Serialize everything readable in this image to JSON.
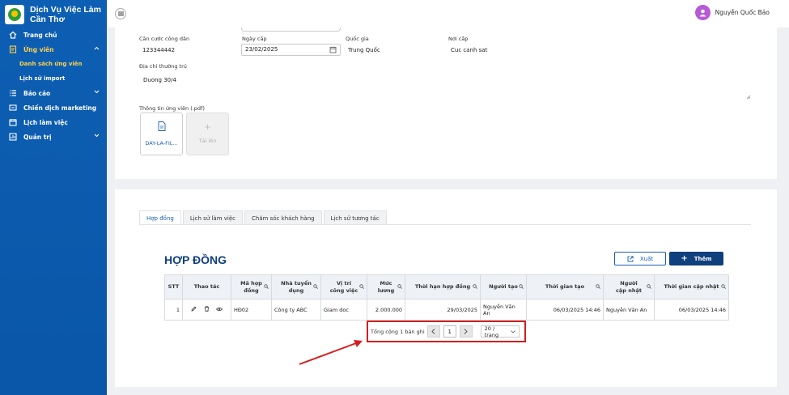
{
  "app": {
    "brand_line1": "Dịch Vụ Việc Làm",
    "brand_line2": "Cần Thơ"
  },
  "sidebar": {
    "items": [
      {
        "label": "Trang chủ",
        "icon": "home-icon"
      },
      {
        "label": "Ứng viên",
        "icon": "candidate-icon",
        "active": true
      },
      {
        "label": "Báo cáo",
        "icon": "list-icon"
      },
      {
        "label": "Chiến dịch marketing",
        "icon": "campaign-icon"
      },
      {
        "label": "Lịch làm việc",
        "icon": "calendar-icon"
      },
      {
        "label": "Quản trị",
        "icon": "admin-icon"
      }
    ],
    "subitems": [
      {
        "label": "Danh sách ứng viên",
        "active": true
      },
      {
        "label": "Lịch sử import"
      }
    ]
  },
  "topbar": {
    "user_name": "Nguyễn Quốc Bảo"
  },
  "form": {
    "cccd_label": "Căn cước công dân",
    "cccd_value": "123344442",
    "issue_date_label": "Ngày cấp",
    "issue_date_value": "23/02/2025",
    "country_label": "Quốc gia",
    "country_value": "Trung Quốc",
    "place_label": "Nơi cấp",
    "place_value": "Cuc canh sat",
    "address_label": "Địa chỉ thường trú",
    "address_value": "Duong 30/4",
    "files_label": "Thông tin ứng viên (.pdf)",
    "file_name": "DAY-LA-FIL...",
    "upload_label": "Tải lên"
  },
  "tabs": [
    "Hợp đồng",
    "Lịch sử làm việc",
    "Chăm sóc khách hàng",
    "Lịch sử tương tác"
  ],
  "section": {
    "title": "HỢP ĐỒNG",
    "export_label": "Xuất",
    "add_label": "Thêm"
  },
  "table": {
    "headers": [
      "STT",
      "Thao tác",
      "Mã hợp đồng",
      "Nhà tuyển dụng",
      "Vị trí công việc",
      "Mức lương",
      "Thời hạn hợp đồng",
      "Người tạo",
      "Thời gian tạo",
      "Người cập nhật",
      "Thời gian cập nhật"
    ],
    "rows": [
      [
        "1",
        "",
        "HĐ02",
        "Công ty ABC",
        "Giam doc",
        "2.000.000",
        "29/03/2025",
        "Nguyễn Văn An",
        "06/03/2025 14:46",
        "Nguyễn Văn An",
        "06/03/2025 14:46"
      ]
    ]
  },
  "pagination": {
    "total_text": "Tổng cộng 1 bản ghi",
    "current_page": "1",
    "page_size": "20 / trang"
  },
  "colors": {
    "sidebar": "#0d5fb3",
    "accent": "#0f3f7c",
    "highlight": "#d21f1f",
    "active_menu": "#ffd24d"
  }
}
